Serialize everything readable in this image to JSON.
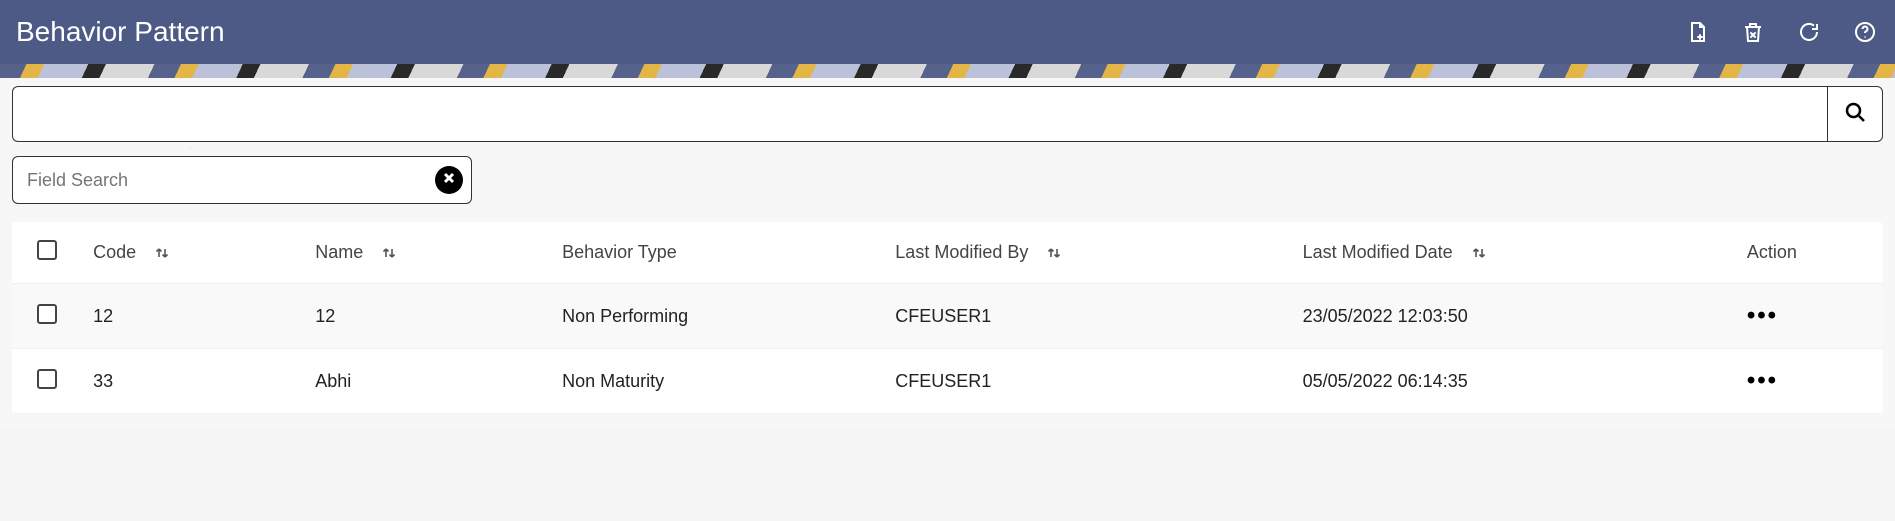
{
  "header": {
    "title": "Behavior Pattern",
    "icons": {
      "new": "new-document-icon",
      "delete": "trash-icon",
      "refresh": "refresh-icon",
      "help": "help-icon"
    }
  },
  "search": {
    "value": "",
    "placeholder": ""
  },
  "field_search": {
    "value": "",
    "placeholder": "Field Search"
  },
  "table": {
    "columns": {
      "code": "Code",
      "name": "Name",
      "behavior_type": "Behavior Type",
      "last_modified_by": "Last Modified By",
      "last_modified_date": "Last Modified Date",
      "action": "Action"
    },
    "rows": [
      {
        "code": "12",
        "name": "12",
        "behavior_type": "Non Performing",
        "last_modified_by": "CFEUSER1",
        "last_modified_date": "23/05/2022 12:03:50"
      },
      {
        "code": "33",
        "name": "Abhi",
        "behavior_type": "Non Maturity",
        "last_modified_by": "CFEUSER1",
        "last_modified_date": "05/05/2022 06:14:35"
      }
    ]
  }
}
